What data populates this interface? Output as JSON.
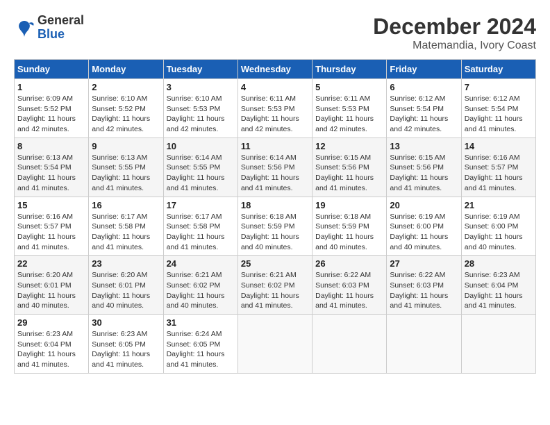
{
  "header": {
    "logo_line1": "General",
    "logo_line2": "Blue",
    "title": "December 2024",
    "subtitle": "Matemandia, Ivory Coast"
  },
  "calendar": {
    "columns": [
      "Sunday",
      "Monday",
      "Tuesday",
      "Wednesday",
      "Thursday",
      "Friday",
      "Saturday"
    ],
    "weeks": [
      [
        null,
        null,
        null,
        null,
        null,
        null,
        null
      ]
    ],
    "days": {
      "1": {
        "sunrise": "6:09 AM",
        "sunset": "5:52 PM",
        "daylight": "11 hours and 42 minutes."
      },
      "2": {
        "sunrise": "6:10 AM",
        "sunset": "5:52 PM",
        "daylight": "11 hours and 42 minutes."
      },
      "3": {
        "sunrise": "6:10 AM",
        "sunset": "5:53 PM",
        "daylight": "11 hours and 42 minutes."
      },
      "4": {
        "sunrise": "6:11 AM",
        "sunset": "5:53 PM",
        "daylight": "11 hours and 42 minutes."
      },
      "5": {
        "sunrise": "6:11 AM",
        "sunset": "5:53 PM",
        "daylight": "11 hours and 42 minutes."
      },
      "6": {
        "sunrise": "6:12 AM",
        "sunset": "5:54 PM",
        "daylight": "11 hours and 42 minutes."
      },
      "7": {
        "sunrise": "6:12 AM",
        "sunset": "5:54 PM",
        "daylight": "11 hours and 41 minutes."
      },
      "8": {
        "sunrise": "6:13 AM",
        "sunset": "5:54 PM",
        "daylight": "11 hours and 41 minutes."
      },
      "9": {
        "sunrise": "6:13 AM",
        "sunset": "5:55 PM",
        "daylight": "11 hours and 41 minutes."
      },
      "10": {
        "sunrise": "6:14 AM",
        "sunset": "5:55 PM",
        "daylight": "11 hours and 41 minutes."
      },
      "11": {
        "sunrise": "6:14 AM",
        "sunset": "5:56 PM",
        "daylight": "11 hours and 41 minutes."
      },
      "12": {
        "sunrise": "6:15 AM",
        "sunset": "5:56 PM",
        "daylight": "11 hours and 41 minutes."
      },
      "13": {
        "sunrise": "6:15 AM",
        "sunset": "5:56 PM",
        "daylight": "11 hours and 41 minutes."
      },
      "14": {
        "sunrise": "6:16 AM",
        "sunset": "5:57 PM",
        "daylight": "11 hours and 41 minutes."
      },
      "15": {
        "sunrise": "6:16 AM",
        "sunset": "5:57 PM",
        "daylight": "11 hours and 41 minutes."
      },
      "16": {
        "sunrise": "6:17 AM",
        "sunset": "5:58 PM",
        "daylight": "11 hours and 41 minutes."
      },
      "17": {
        "sunrise": "6:17 AM",
        "sunset": "5:58 PM",
        "daylight": "11 hours and 41 minutes."
      },
      "18": {
        "sunrise": "6:18 AM",
        "sunset": "5:59 PM",
        "daylight": "11 hours and 40 minutes."
      },
      "19": {
        "sunrise": "6:18 AM",
        "sunset": "5:59 PM",
        "daylight": "11 hours and 40 minutes."
      },
      "20": {
        "sunrise": "6:19 AM",
        "sunset": "6:00 PM",
        "daylight": "11 hours and 40 minutes."
      },
      "21": {
        "sunrise": "6:19 AM",
        "sunset": "6:00 PM",
        "daylight": "11 hours and 40 minutes."
      },
      "22": {
        "sunrise": "6:20 AM",
        "sunset": "6:01 PM",
        "daylight": "11 hours and 40 minutes."
      },
      "23": {
        "sunrise": "6:20 AM",
        "sunset": "6:01 PM",
        "daylight": "11 hours and 40 minutes."
      },
      "24": {
        "sunrise": "6:21 AM",
        "sunset": "6:02 PM",
        "daylight": "11 hours and 40 minutes."
      },
      "25": {
        "sunrise": "6:21 AM",
        "sunset": "6:02 PM",
        "daylight": "11 hours and 41 minutes."
      },
      "26": {
        "sunrise": "6:22 AM",
        "sunset": "6:03 PM",
        "daylight": "11 hours and 41 minutes."
      },
      "27": {
        "sunrise": "6:22 AM",
        "sunset": "6:03 PM",
        "daylight": "11 hours and 41 minutes."
      },
      "28": {
        "sunrise": "6:23 AM",
        "sunset": "6:04 PM",
        "daylight": "11 hours and 41 minutes."
      },
      "29": {
        "sunrise": "6:23 AM",
        "sunset": "6:04 PM",
        "daylight": "11 hours and 41 minutes."
      },
      "30": {
        "sunrise": "6:23 AM",
        "sunset": "6:05 PM",
        "daylight": "11 hours and 41 minutes."
      },
      "31": {
        "sunrise": "6:24 AM",
        "sunset": "6:05 PM",
        "daylight": "11 hours and 41 minutes."
      }
    }
  }
}
